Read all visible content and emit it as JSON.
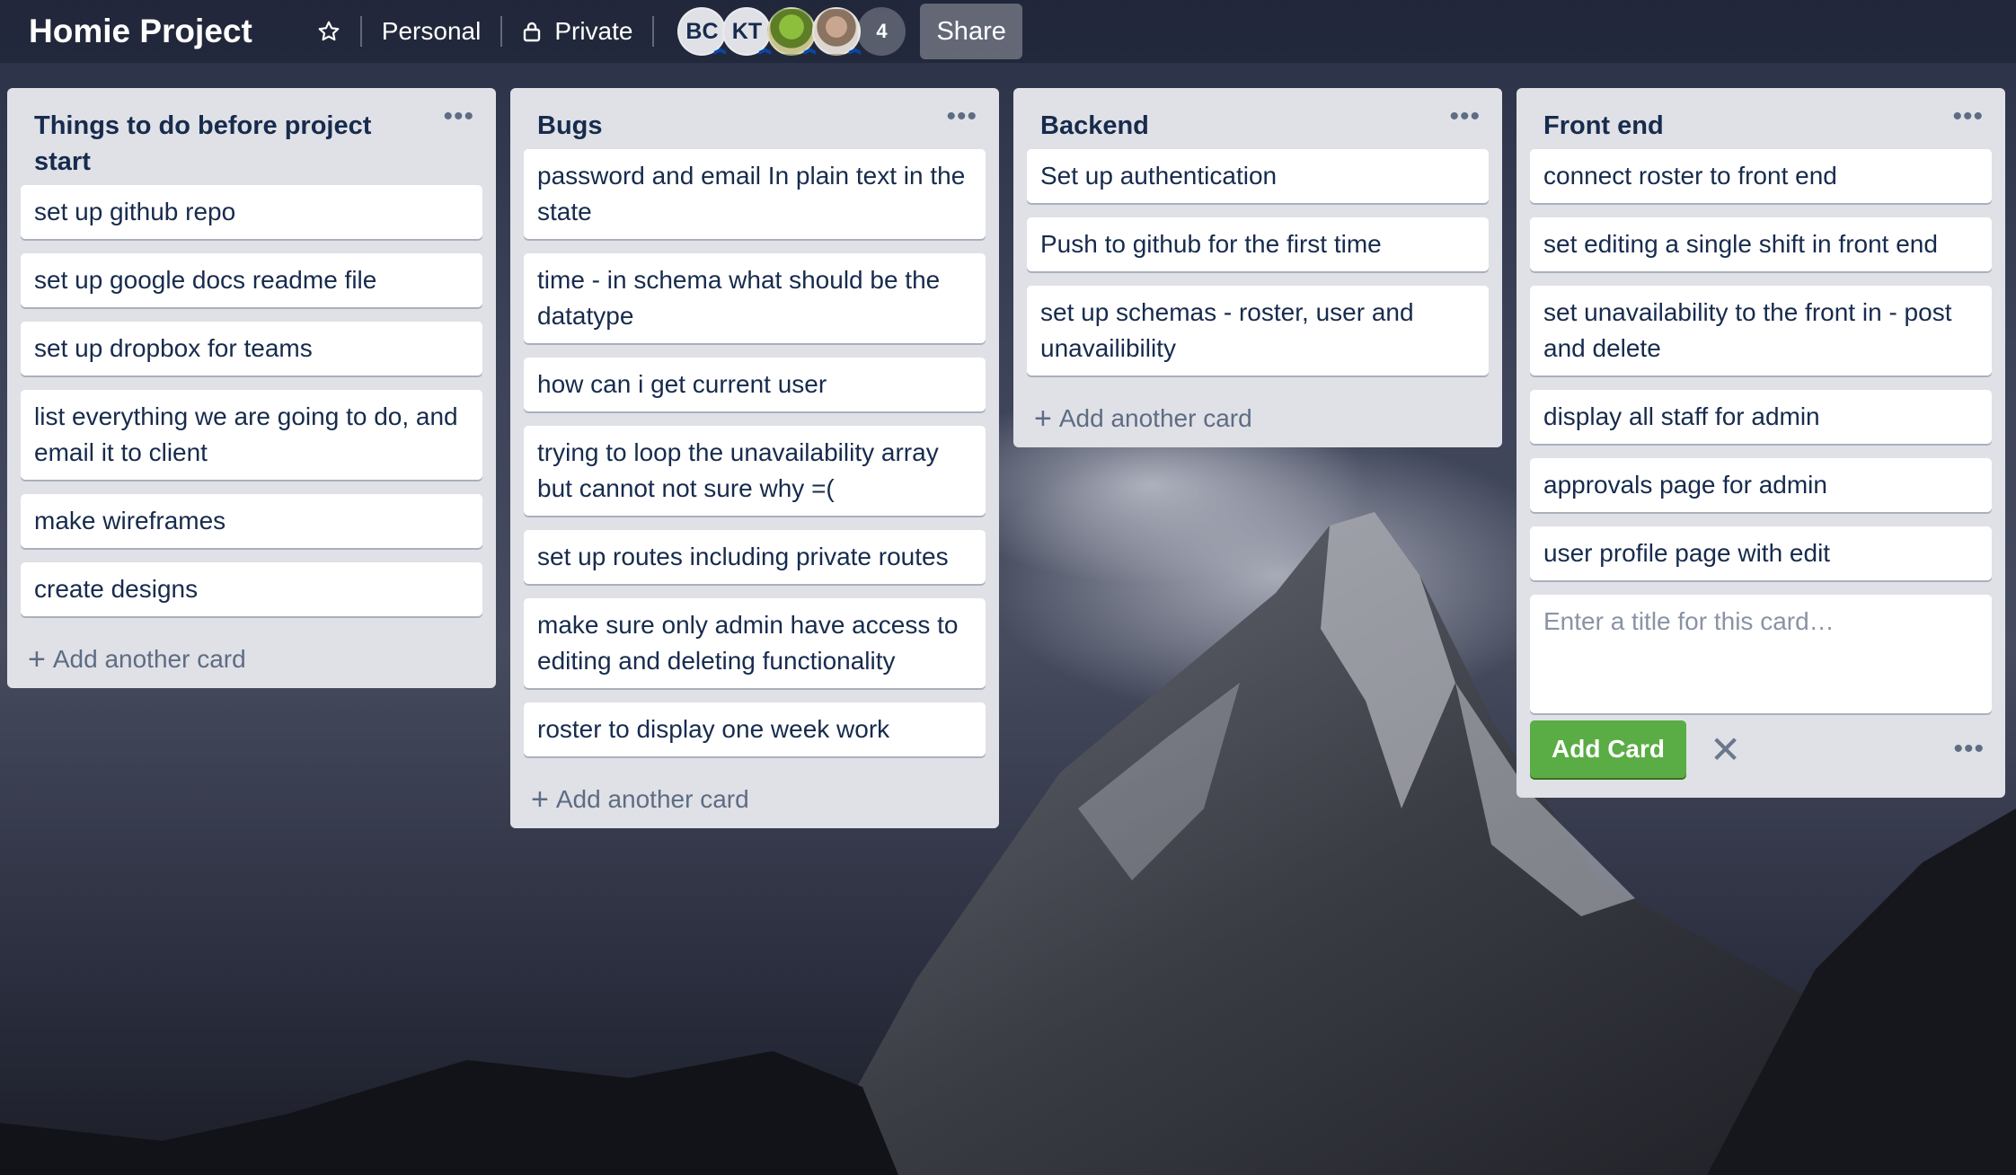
{
  "board": {
    "title": "Homie Project",
    "visibility_team": "Personal",
    "visibility_privacy": "Private",
    "share_label": "Share"
  },
  "members": [
    {
      "initials": "BC"
    },
    {
      "initials": "KT"
    },
    {
      "initials": ""
    },
    {
      "initials": ""
    }
  ],
  "member_count": "4",
  "lists": [
    {
      "title": "Things to do before project start",
      "cards": [
        "set up github repo",
        "set up google docs readme file",
        "set up dropbox for teams",
        "list everything we are going to do, and email it to client",
        "make wireframes",
        "create designs"
      ],
      "add_label": "Add another card"
    },
    {
      "title": "Bugs",
      "cards": [
        "password and email In plain text in the state",
        "time - in schema what should be the datatype",
        "how can i get current user",
        "trying to loop the unavailability array but cannot not sure why =(",
        "set up routes including private routes",
        "make sure only admin have access to editing and deleting functionality",
        "roster to display one week work"
      ],
      "add_label": "Add another card"
    },
    {
      "title": "Backend",
      "cards": [
        "Set up authentication",
        "Push to github for the first time",
        "set up schemas - roster, user and unavailibility"
      ],
      "add_label": "Add another card"
    },
    {
      "title": "Front end",
      "cards": [
        "connect roster to front end",
        "set editing a single shift in front end",
        "set unavailability to the front in - post and delete",
        "display all staff for admin",
        "approvals page for admin",
        "user profile page with edit"
      ],
      "composer": {
        "placeholder": "Enter a title for this card…",
        "value": "",
        "add_button": "Add Card"
      }
    }
  ],
  "icons": {
    "star": "star-icon",
    "lock": "lock-icon",
    "more": "more-icon",
    "plus": "plus-icon",
    "close": "close-icon"
  },
  "colors": {
    "list_bg": "#dfe1e6",
    "add_button": "#5aac44",
    "text": "#172b4d"
  }
}
